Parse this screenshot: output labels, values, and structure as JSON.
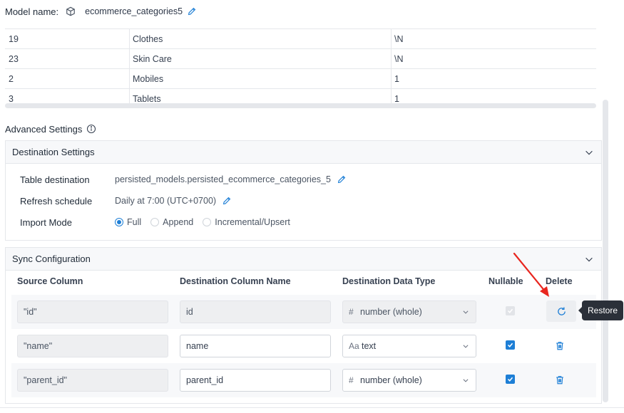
{
  "model": {
    "label": "Model name:",
    "name": "ecommerce_categories5"
  },
  "preview_rows": [
    [
      "19",
      "Clothes",
      "\\N"
    ],
    [
      "23",
      "Skin Care",
      "\\N"
    ],
    [
      "2",
      "Mobiles",
      "1"
    ],
    [
      "3",
      "Tablets",
      "1"
    ]
  ],
  "advanced": {
    "title": "Advanced Settings"
  },
  "destination": {
    "title": "Destination Settings",
    "table_label": "Table destination",
    "table_value": "persisted_models.persisted_ecommerce_categories_5",
    "schedule_label": "Refresh schedule",
    "schedule_value": "Daily at 7:00 (UTC+0700)",
    "mode_label": "Import Mode",
    "modes": [
      {
        "label": "Full",
        "selected": true
      },
      {
        "label": "Append",
        "selected": false
      },
      {
        "label": "Incremental/Upsert",
        "selected": false
      }
    ]
  },
  "sync": {
    "title": "Sync Configuration",
    "headers": {
      "source": "Source Column",
      "dest_name": "Destination Column Name",
      "dest_type": "Destination Data Type",
      "nullable": "Nullable",
      "delete": "Delete"
    },
    "rows": [
      {
        "source": "\"id\"",
        "dest_name": "id",
        "type_icon": "#",
        "type": "number (whole)",
        "nullable": true,
        "disabled": true
      },
      {
        "source": "\"name\"",
        "dest_name": "name",
        "type_icon": "Aa",
        "type": "text",
        "nullable": true,
        "disabled": false
      },
      {
        "source": "\"parent_id\"",
        "dest_name": "parent_id",
        "type_icon": "#",
        "type": "number (whole)",
        "nullable": true,
        "disabled": false
      }
    ]
  },
  "tooltip": {
    "text": "Restore"
  },
  "colors": {
    "accent": "#1e7fd6",
    "annotation_arrow": "#e8261f",
    "tooltip_bg": "#2b3039"
  }
}
